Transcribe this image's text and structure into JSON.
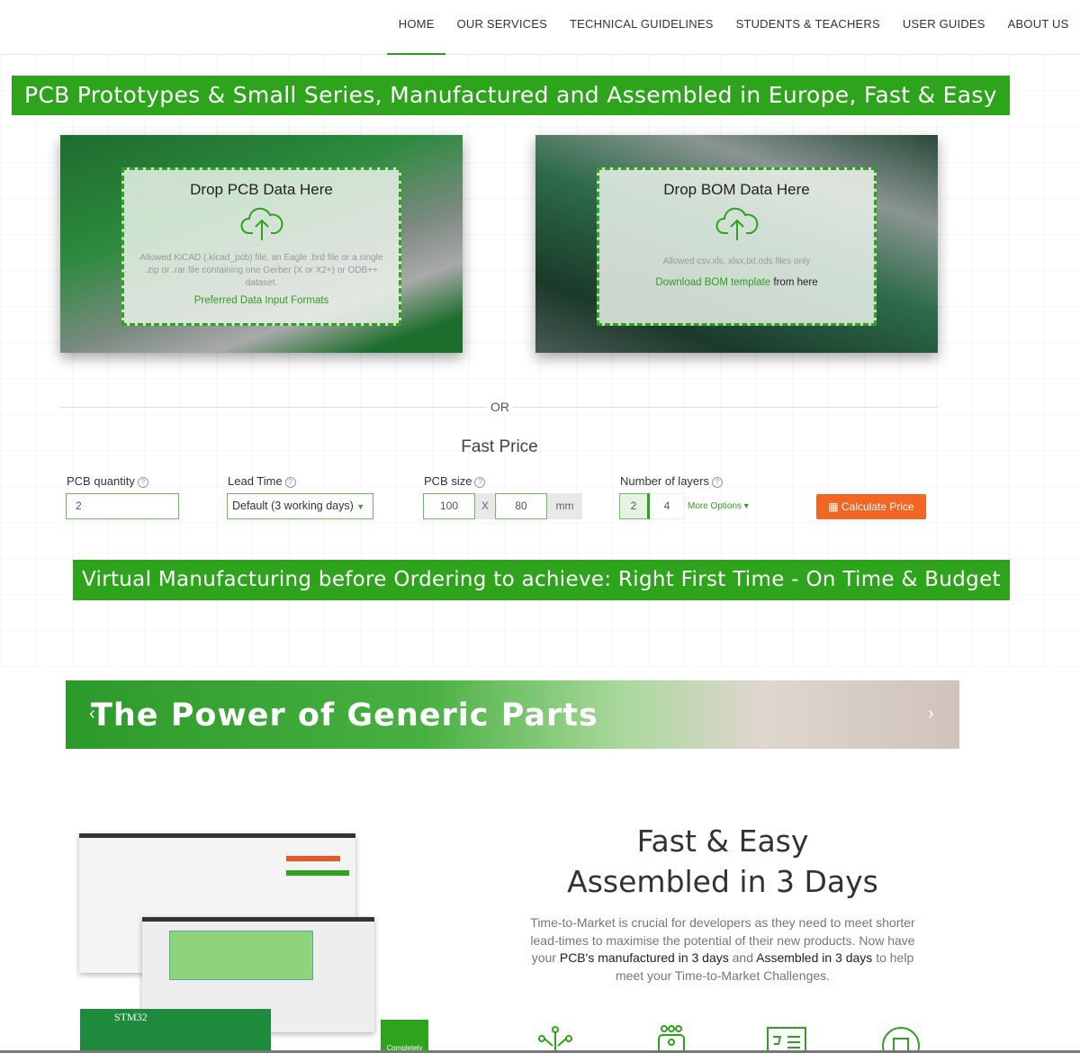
{
  "nav": [
    "HOME",
    "OUR SERVICES",
    "TECHNICAL GUIDELINES",
    "STUDENTS & TEACHERS",
    "USER GUIDES",
    "ABOUT US"
  ],
  "banner1": "PCB Prototypes & Small Series, Manufactured and Assembled in Europe, Fast & Easy",
  "pcb_drop": {
    "title": "Drop PCB Data Here",
    "note": "Allowed KiCAD (.kicad_pcb) file, an Eagle .brd file or a single .zip or .rar file containing one Gerber (X or X2+) or ODB++ dataset.",
    "link": "Preferred Data Input Formats"
  },
  "bom_drop": {
    "title": "Drop BOM Data Here",
    "note": "Allowed csv,xls, xlsx,txt,ods files only",
    "link": "Download BOM template",
    "link_suffix": " from here"
  },
  "or": "OR",
  "fast_price": {
    "title": "Fast Price",
    "qty_label": "PCB quantity",
    "qty": "2",
    "lead_label": "Lead Time",
    "lead": "Default (3 working days)",
    "size_label": "PCB size",
    "size_x": "100",
    "x": "X",
    "size_y": "80",
    "unit": "mm",
    "layers_label": "Number of layers",
    "layer_a": "2",
    "layer_b": "4",
    "more": "More Options",
    "calc": "Calculate Price",
    "help": "?"
  },
  "banner2": "Virtual Manufacturing before Ordering to achieve: Right First Time - On Time & Budget",
  "slider": {
    "title": "The Power of Generic Parts"
  },
  "board_label": "STM32",
  "badge": "Completely",
  "feature": {
    "h1": "Fast & Easy",
    "h2": "Assembled in 3 Days",
    "p1": "Time-to-Market is crucial for developers as they need to meet shorter lead-times to maximise the potential of their new products. Now have your ",
    "b1": "PCB's manufactured in 3 days",
    "p2": " and ",
    "b2": "Assembled in 3 days",
    "p3": " to help meet your Time-to-Market Challenges."
  },
  "colors": {
    "accent": "#2ea31c",
    "button": "#f26522"
  },
  "icons": [
    "circuit-tree-icon",
    "chip-network-icon",
    "shopping-list-icon",
    "gear-pcb-icon"
  ]
}
